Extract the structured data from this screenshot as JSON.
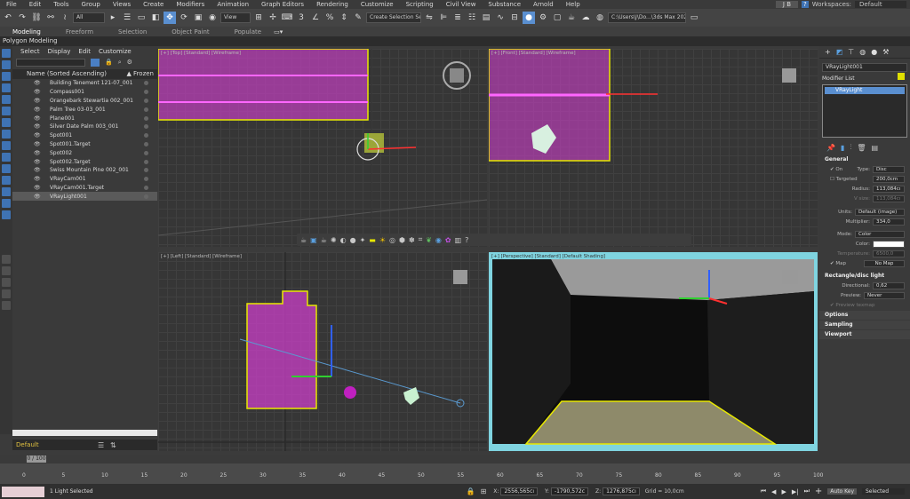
{
  "menubar": {
    "items": [
      "File",
      "Edit",
      "Tools",
      "Group",
      "Views",
      "Create",
      "Modifiers",
      "Animation",
      "Graph Editors",
      "Rendering",
      "Customize",
      "Scripting",
      "Civil View",
      "Substance",
      "Arnold",
      "Help"
    ],
    "user": "J B",
    "workspace_label": "Workspaces:",
    "workspace_value": "Default"
  },
  "toolbar": {
    "selection_filter": "All",
    "ref_coord": "View",
    "selection_set": "Create Selection Se",
    "project_path": "C:\\Users\\J\\Do...\\3ds Max 202"
  },
  "ribbon": {
    "tabs": [
      "Modeling",
      "Freeform",
      "Selection",
      "Object Paint",
      "Populate"
    ],
    "subtitle": "Polygon Modeling"
  },
  "explorer": {
    "menu": [
      "Select",
      "Display",
      "Edit",
      "Customize"
    ],
    "col_name": "Name (Sorted Ascending)",
    "col_frozen": "▲ Frozen",
    "rows": [
      "Building Tenement 121-07_001",
      "Compass001",
      "Orangebark Stewartia 002_001",
      "Palm Tree 03-03_001",
      "Plane001",
      "Silver Date Palm 003_001",
      "Spot001",
      "Spot001.Target",
      "Spot002",
      "Spot002.Target",
      "Swiss Mountain Pine 002_001",
      "VRayCam001",
      "VRayCam001.Target",
      "VRayLight001"
    ],
    "layer": "Default"
  },
  "viewports": {
    "top": "[+] [Top] [Standard] [Wireframe]",
    "front": "[+] [Front] [Standard] [Wireframe]",
    "left": "[+] [Left] [Standard] [Wireframe]",
    "persp": "[+] [Perspective] [Standard] [Default Shading]"
  },
  "timeline": {
    "frame": "0 / 100",
    "ticks": [
      "0",
      "5",
      "10",
      "15",
      "20",
      "25",
      "30",
      "35",
      "40",
      "45",
      "50",
      "55",
      "60",
      "65",
      "70",
      "75",
      "80",
      "85",
      "90",
      "95",
      "100"
    ]
  },
  "status": {
    "message": "1 Light Selected",
    "x": "2556,565cı",
    "y": "-1790,572c",
    "z": "1276,875cı",
    "grid": "Grid = 10,0cm",
    "auto_key": "Auto Key",
    "selected": "Selected"
  },
  "command_panel": {
    "object_name": "VRayLight001",
    "modifier_list": "Modifier List",
    "stack_item": "VRayLight",
    "general": "General",
    "on_label": "On",
    "type_label": "Type:",
    "type_value": "Disc",
    "targeted_label": "Targeted",
    "targeted_value": "200,0cm",
    "radius_label": "Radius:",
    "radius_value": "113,084cı",
    "vsize_label": "V size:",
    "vsize_value": "113,084cı",
    "units_label": "Units:",
    "units_value": "Default (image)",
    "multiplier_label": "Multiplier:",
    "multiplier_value": "334,0",
    "mode_label": "Mode:",
    "mode_value": "Color",
    "color_label": "Color:",
    "temperature_label": "Temperature:",
    "temperature_value": "6500,0",
    "map_label": "Map",
    "map_value": "No Map",
    "rectdisc": "Rectangle/disc light",
    "directional_label": "Directional:",
    "directional_value": "0,62",
    "preview_label": "Preview:",
    "preview_value": "Never",
    "preview_texmap": "Preview texmap",
    "options": "Options",
    "sampling": "Sampling",
    "viewport": "Viewport"
  },
  "colors": {
    "accent": "#5a8fd0",
    "selection": "#e8e800",
    "magenta": "#c23fbf"
  }
}
